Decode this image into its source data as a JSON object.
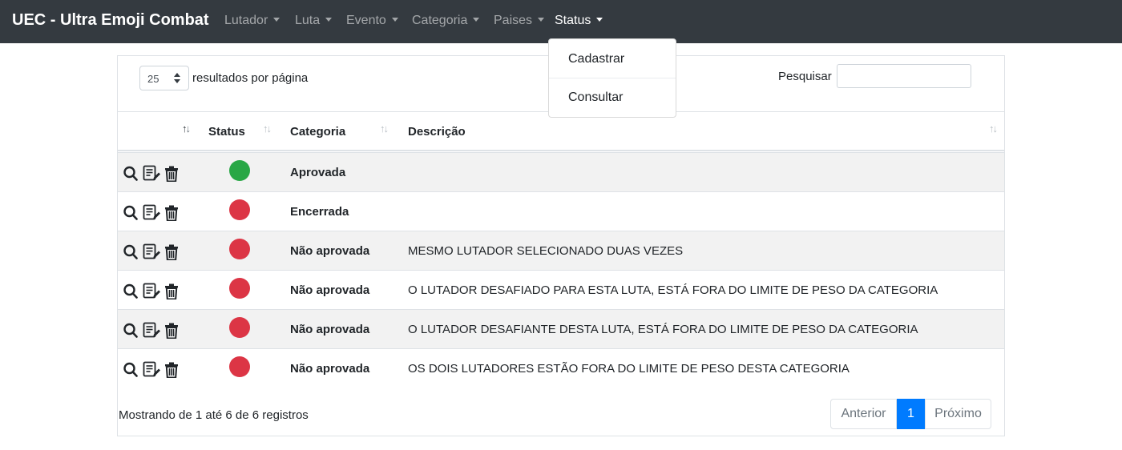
{
  "navbar": {
    "brand": "UEC - Ultra Emoji Combat",
    "menus": [
      {
        "label": "Lutador"
      },
      {
        "label": "Luta"
      },
      {
        "label": "Evento"
      },
      {
        "label": "Categoria"
      },
      {
        "label": "Paises"
      },
      {
        "label": "Status"
      }
    ],
    "active_menu": "Status",
    "dropdown": {
      "items": [
        {
          "label": "Cadastrar"
        },
        {
          "label": "Consultar"
        }
      ]
    }
  },
  "table_controls": {
    "page_length": "25",
    "page_length_label": "resultados por página",
    "search_label": "Pesquisar",
    "search_value": ""
  },
  "table": {
    "columns": [
      {
        "label": ""
      },
      {
        "label": "Status"
      },
      {
        "label": "Categoria"
      },
      {
        "label": "Descrição"
      }
    ],
    "row_icons": [
      "search-icon",
      "edit-icon",
      "trash-icon"
    ],
    "rows": [
      {
        "status_color": "#28a745",
        "categoria": "Aprovada",
        "descricao": ""
      },
      {
        "status_color": "#dc3545",
        "categoria": "Encerrada",
        "descricao": ""
      },
      {
        "status_color": "#dc3545",
        "categoria": "Não aprovada",
        "descricao": "MESMO LUTADOR SELECIONADO DUAS VEZES"
      },
      {
        "status_color": "#dc3545",
        "categoria": "Não aprovada",
        "descricao": "O LUTADOR DESAFIADO PARA ESTA LUTA, ESTÁ FORA DO LIMITE DE PESO DA CATEGORIA"
      },
      {
        "status_color": "#dc3545",
        "categoria": "Não aprovada",
        "descricao": "O LUTADOR DESAFIANTE DESTA LUTA, ESTÁ FORA DO LIMITE DE PESO DA CATEGORIA"
      },
      {
        "status_color": "#dc3545",
        "categoria": "Não aprovada",
        "descricao": "OS DOIS LUTADORES ESTÃO FORA DO LIMITE DE PESO DESTA CATEGORIA"
      }
    ]
  },
  "footer": {
    "info": "Mostrando de 1 até 6 de 6 registros",
    "pagination": {
      "previous": "Anterior",
      "current": "1",
      "next": "Próximo"
    }
  },
  "colors": {
    "navbar": "#343a40",
    "primary": "#007bff",
    "approved": "#28a745",
    "rejected": "#dc3545",
    "stripe": "#f2f2f2"
  }
}
